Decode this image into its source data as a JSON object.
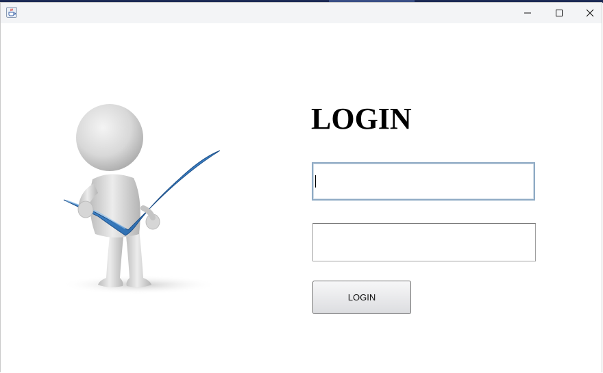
{
  "window": {
    "app_icon": "java-coffee-icon",
    "controls": {
      "minimize_icon": "minimize-icon",
      "maximize_icon": "maximize-icon",
      "close_icon": "close-icon"
    }
  },
  "illustration": {
    "description_icon": "person-with-checkmark-icon"
  },
  "form": {
    "title": "LOGIN",
    "username_value": "",
    "password_value": "",
    "login_button_label": "LOGIN"
  },
  "colors": {
    "checkmark": "#3a7ec2",
    "focus_border": "#8eaac4",
    "titlebar": "#f3f4f6"
  }
}
